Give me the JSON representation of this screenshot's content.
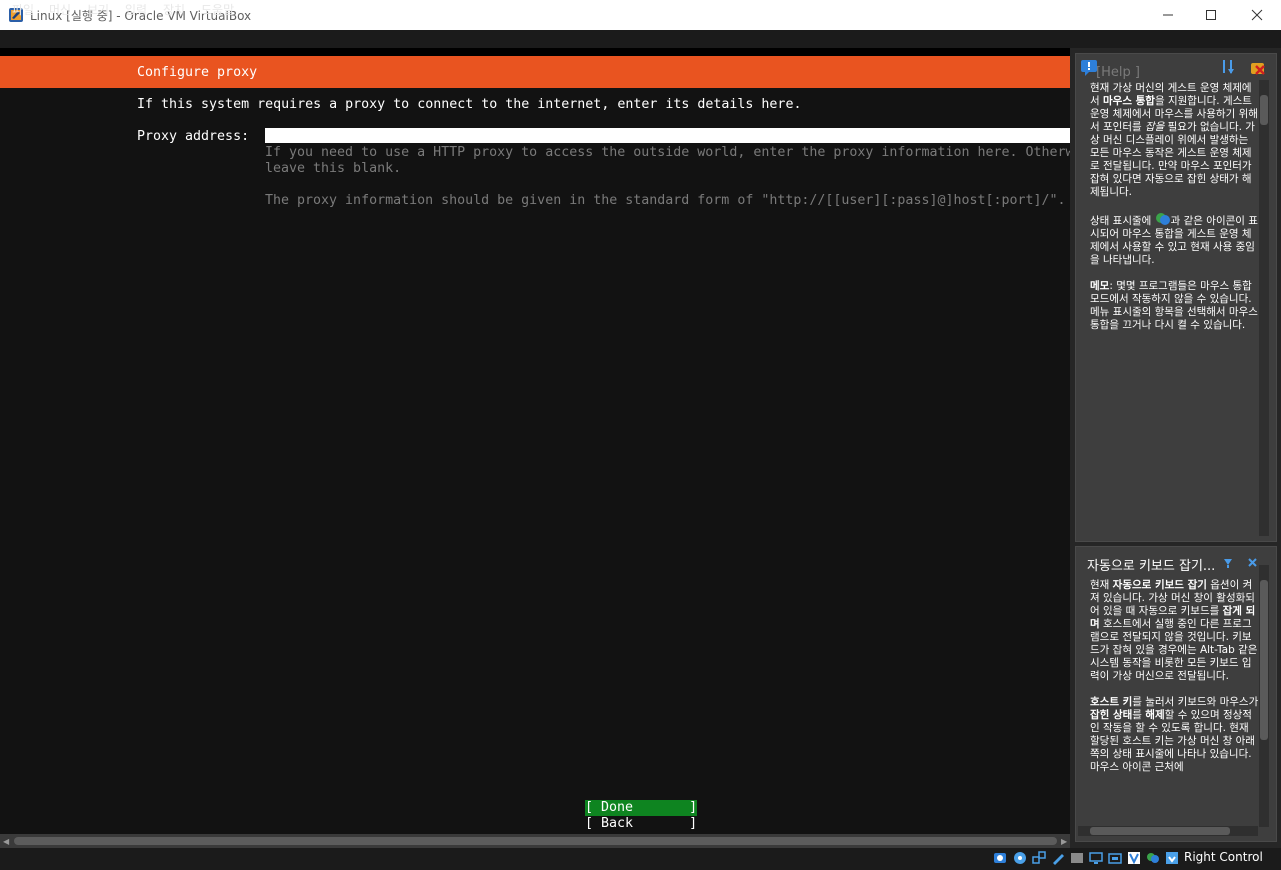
{
  "window": {
    "title": "Linux [실행 중] - Oracle VM VirtualBox",
    "minimize_icon": "minimize-icon",
    "maximize_icon": "maximize-icon",
    "close_icon": "close-icon"
  },
  "menubar": {
    "items": [
      "파일",
      "머신",
      "보기",
      "입력",
      "장치",
      "도움말"
    ]
  },
  "vm": {
    "header": "Configure proxy",
    "intro": "If this system requires a proxy to connect to the internet, enter its details here.",
    "proxy_label": "Proxy address:",
    "proxy_value": "",
    "hint_line1": "If you need to use a HTTP proxy to access the outside world, enter the proxy information here. Otherw",
    "hint_line2": "leave this blank.",
    "hint_line3": "The proxy information should be given in the standard form of \"http://[[user][:pass]@]host[:port]/\".",
    "done_button": "[ Done       ]",
    "back_button": "[ Back       ]",
    "accent_color": "#e95420",
    "button_color": "#0e8420"
  },
  "panel_mouse": {
    "partial_title": "[Help ]",
    "p1_prefix": "현재 가상 머신의 게스트 운영 체제에서 ",
    "p1_bold1": "마우스 통합",
    "p1_mid1": "을 지원합니다. 게스트 운영 체제에서 마우스를 사용하기 위해서 포인터를 ",
    "p1_italic": "잡을",
    "p1_mid2": " 필요가 없습니다. 가상 머신 디스플레이 위에서 발생하는 모든 마우스 동작은 게스트 운영 체제로 전달됩니다. 만약 마우스 포인터가 잡혀 있다면 자동으로 잡힌 상태가 해제됩니다.",
    "p2_prefix": "상태 표시줄에 ",
    "p2_suffix": "과 같은 아이콘이 표시되어 마우스 통합을 게스트 운영 체제에서 사용할 수 있고 현재 사용 중임을 나타냅니다.",
    "p3_bold": "메모",
    "p3_text": ": 몇몇 프로그램들은 마우스 통합 모드에서 작동하지 않을 수 있습니다. 메뉴 표시줄의 항목을 선택해서 마우스 통합을 끄거나 다시 켤 수 있습니다."
  },
  "panel_keyboard": {
    "title": "자동으로 키보드 잡기...",
    "p1_prefix": "현재 ",
    "p1_bold1": "자동으로 키보드 잡기",
    "p1_mid1": " 옵션이 켜져 있습니다. 가상 머신 창이 활성화되어 있을 때 자동으로 키보드를 ",
    "p1_bold2": "잡게 되며",
    "p1_suffix": " 호스트에서 실행 중인 다른 프로그램으로 전달되지 않을 것입니다. 키보드가 잡혀 있을 경우에는 Alt-Tab 같은 시스템 동작을 비롯한 모든 키보드 입력이 가상 머신으로 전달됩니다.",
    "p2_bold1": "호스트 키",
    "p2_mid1": "를 눌러서 키보드와 마우스가 ",
    "p2_bold2": "잡힌 상태",
    "p2_mid2": "를 ",
    "p2_bold3": "해제",
    "p2_suffix": "할 수 있으며 정상적인 작동을 할 수 있도록 합니다. 현재 할당된 호스트 키는 가상 머신 창 아래쪽의 상태 표시줄에 나타나 있습니다. 마우스 아이콘 근처에"
  },
  "statusbar": {
    "host_key": "Right Control",
    "icons": [
      "hard-disk-icon",
      "optical-drive-icon",
      "network-icon",
      "usb-icon",
      "shared-folder-icon",
      "display-icon",
      "recording-icon",
      "virtualization-icon",
      "mouse-integration-icon",
      "keyboard-capture-icon"
    ]
  }
}
